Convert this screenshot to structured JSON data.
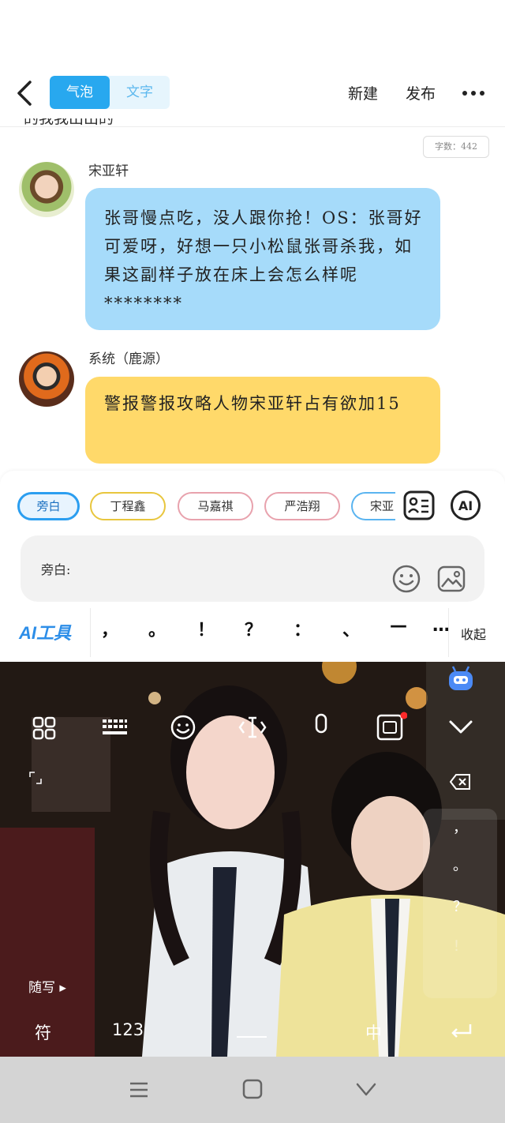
{
  "header": {
    "tabs": [
      {
        "label": "气泡",
        "active": true
      },
      {
        "label": "文字",
        "active": false
      }
    ],
    "new_label": "新建",
    "publish_label": "发布",
    "cut_off_text": "的我我出出的",
    "char_count": "字数：442"
  },
  "messages": [
    {
      "name": "宋亚轩",
      "text": "张哥慢点吃，没人跟你抢！OS：张哥好可爱呀，好想一只小松鼠张哥杀我，如果这副样子放在床上会怎么样呢********",
      "bubble_color": "#a6dbfa"
    },
    {
      "name": "系统（鹿源）",
      "text": "警报警报攻略人物宋亚轩占有欲加15",
      "bubble_color": "#ffd96a"
    }
  ],
  "composer": {
    "roles": [
      "旁白",
      "丁程鑫",
      "马嘉祺",
      "严浩翔",
      "宋亚"
    ],
    "ai_label": "AI",
    "input_label": "旁白:",
    "ai_tools_label": "AI工具",
    "punctuation": [
      "，",
      "。",
      "！",
      "？",
      "：",
      "、",
      "—",
      "…"
    ],
    "collapse_label": "收起"
  },
  "keyboard": {
    "handwrite_label": "随写 ▸",
    "symbol_label": "符",
    "number_label": "123",
    "chinese_label": "中",
    "side_keys": [
      "，",
      "。",
      "？",
      "！"
    ]
  },
  "colors": {
    "accent": "#28a8ef",
    "bubble_blue": "#a6dbfa",
    "bubble_yellow": "#ffd96a",
    "ai_tools_blue": "#2d8ee8"
  },
  "icons": [
    "chevron-left-icon",
    "more-icon",
    "role-card-icon",
    "ai-icon",
    "emoji-icon",
    "image-icon",
    "robot-icon",
    "grid-icon",
    "keyboard-icon",
    "cursor-icon",
    "mic-icon",
    "sticker-icon",
    "chevron-down-icon",
    "expand-icon",
    "backspace-icon",
    "enter-icon",
    "menu-icon",
    "home-icon",
    "back-icon"
  ]
}
